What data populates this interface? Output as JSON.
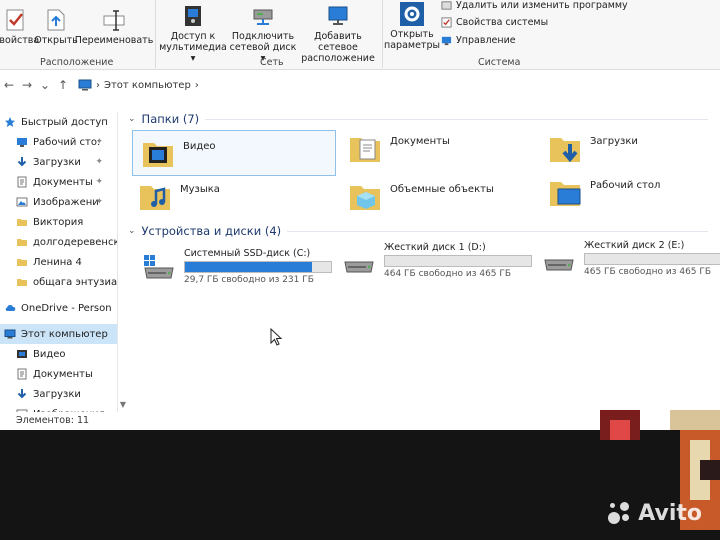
{
  "ribbon": {
    "properties_label": "Свойства",
    "open_label": "Открыть",
    "rename_label": "Переименовать",
    "location_group": "Расположение",
    "media_access_label_1": "Доступ к",
    "media_access_label_2": "мультимедиа",
    "map_drive_label_1": "Подключить",
    "map_drive_label_2": "сетевой диск",
    "add_location_label_1": "Добавить сетевое",
    "add_location_label_2": "расположение",
    "network_group": "Сеть",
    "open_settings_label_1": "Открыть",
    "open_settings_label_2": "параметры",
    "uninstall_label": "Удалить или изменить программу",
    "system_props_label": "Свойства системы",
    "manage_label": "Управление",
    "system_group": "Система",
    "dropdown_arrow": "▾"
  },
  "address": {
    "back": "←",
    "forward": "→",
    "recent": "⌄",
    "up": "↑",
    "separator": "›",
    "location": "Этот компьютер",
    "separator2": "›"
  },
  "sidebar": {
    "items": [
      {
        "label": "Быстрый доступ",
        "icon": "star-icon",
        "pinned": false
      },
      {
        "label": "Рабочий сто.",
        "icon": "desktop-icon",
        "pinned": true
      },
      {
        "label": "Загрузки",
        "icon": "download-icon",
        "pinned": true
      },
      {
        "label": "Документы",
        "icon": "document-icon",
        "pinned": true
      },
      {
        "label": "Изображени",
        "icon": "pictures-icon",
        "pinned": true
      },
      {
        "label": "Виктория",
        "icon": "folder-icon",
        "pinned": false
      },
      {
        "label": "долгодеревенск",
        "icon": "folder-icon",
        "pinned": false
      },
      {
        "label": "Ленина 4",
        "icon": "folder-icon",
        "pinned": false
      },
      {
        "label": "общага энтузиа",
        "icon": "folder-icon",
        "pinned": false
      },
      {
        "label": "OneDrive - Person",
        "icon": "cloud-icon",
        "pinned": false
      },
      {
        "label": "Этот компьютер",
        "icon": "computer-icon",
        "pinned": false
      },
      {
        "label": "Видео",
        "icon": "video-icon",
        "pinned": false
      },
      {
        "label": "Документы",
        "icon": "document-icon",
        "pinned": false
      },
      {
        "label": "Загрузки",
        "icon": "download-icon",
        "pinned": false
      },
      {
        "label": "Изображения",
        "icon": "pictures-icon",
        "pinned": false
      }
    ],
    "pin_glyph": "✦"
  },
  "folders": {
    "title": "Папки (7)",
    "items": [
      {
        "label": "Видео",
        "icon": "video-folder-icon"
      },
      {
        "label": "Документы",
        "icon": "documents-folder-icon"
      },
      {
        "label": "Загрузки",
        "icon": "downloads-folder-icon"
      },
      {
        "label": "Музыка",
        "icon": "music-folder-icon"
      },
      {
        "label": "Объемные объекты",
        "icon": "3d-objects-folder-icon"
      },
      {
        "label": "Рабочий стол",
        "icon": "desktop-folder-icon"
      }
    ]
  },
  "drives": {
    "title": "Устройства и диски (4)",
    "items": [
      {
        "name": "Системный SSD-диск (C:)",
        "free": "29,7 ГБ свободно из 231 ГБ",
        "used_fraction": 0.87,
        "icon": "windows-drive-icon"
      },
      {
        "name": "Жесткий диск 1 (D:)",
        "free": "464 ГБ свободно из 465 ГБ",
        "used_fraction": 0.0,
        "icon": "hard-drive-icon"
      },
      {
        "name": "Жесткий диск 2 (E:)",
        "free": "465 ГБ свободно из 465 ГБ",
        "used_fraction": 0.0,
        "icon": "hard-drive-icon"
      }
    ]
  },
  "status": {
    "items_count": "Элементов: 11"
  },
  "watermark": "Avito",
  "colors": {
    "accent": "#2a7dd6",
    "folder": "#e8c25a",
    "selected": "#cce4f7"
  }
}
